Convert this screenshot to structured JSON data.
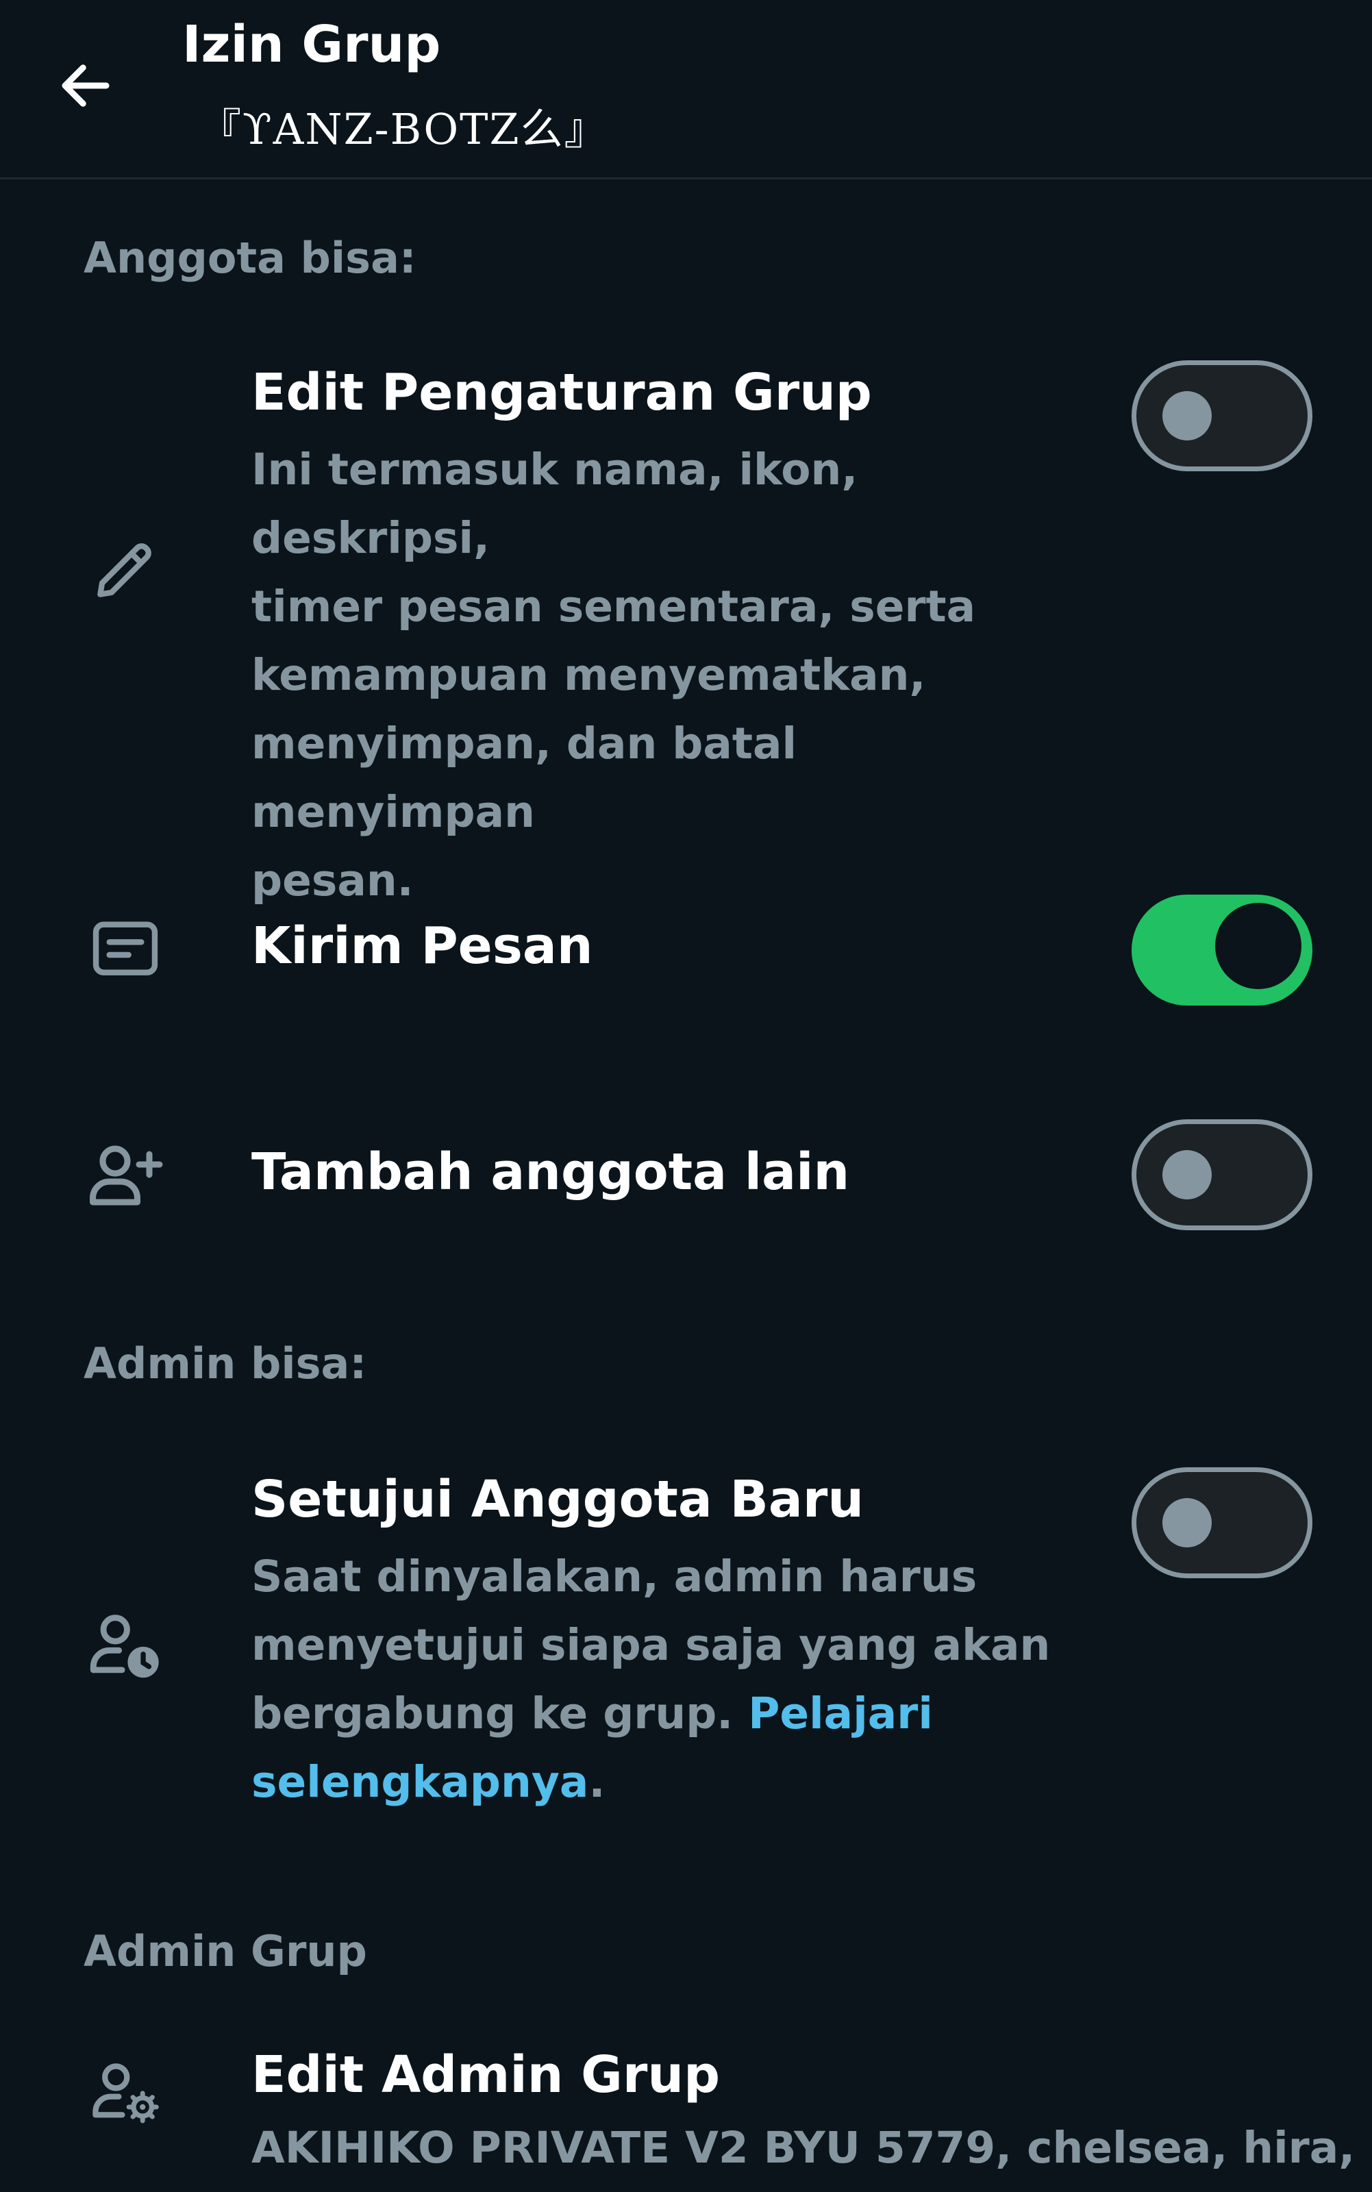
{
  "header": {
    "title": "Izin Grup",
    "subtitle": "『ϒANZ-BOTZ么』"
  },
  "members_section": {
    "label": "Anggota bisa:",
    "items": [
      {
        "title": "Edit Pengaturan Grup",
        "description_lines": [
          "Ini termasuk nama, ikon, deskripsi,",
          "timer pesan sementara, serta",
          "kemampuan menyematkan,",
          "menyimpan, dan batal menyimpan",
          "pesan."
        ],
        "icon": "pencil-icon",
        "toggle_on": false
      },
      {
        "title": "Kirim Pesan",
        "icon": "message-icon",
        "toggle_on": true
      },
      {
        "title": "Tambah anggota lain",
        "icon": "add-person-icon",
        "toggle_on": false
      }
    ]
  },
  "admins_section": {
    "label": "Admin bisa:",
    "items": [
      {
        "title": "Setujui Anggota Baru",
        "description_lines": [
          "Saat dinyalakan, admin harus",
          "menyetujui siapa saja yang akan",
          "bergabung ke grup."
        ],
        "link_part1": "Pelajari",
        "link_part2": "selengkapnya",
        "period": ".",
        "icon": "person-clock-icon",
        "toggle_on": false
      }
    ]
  },
  "group_admin_section": {
    "label": "Admin Grup",
    "items": [
      {
        "title": "Edit Admin Grup",
        "subtitle": "AKIHIKO PRIVATE V2 BYU 5779, chelsea, hira, ...",
        "icon": "person-gear-icon"
      }
    ]
  },
  "colors": {
    "background": "#0b141a",
    "accent_green": "#21c063",
    "link_blue": "#53bdeb",
    "muted_text": "#8696a0"
  }
}
